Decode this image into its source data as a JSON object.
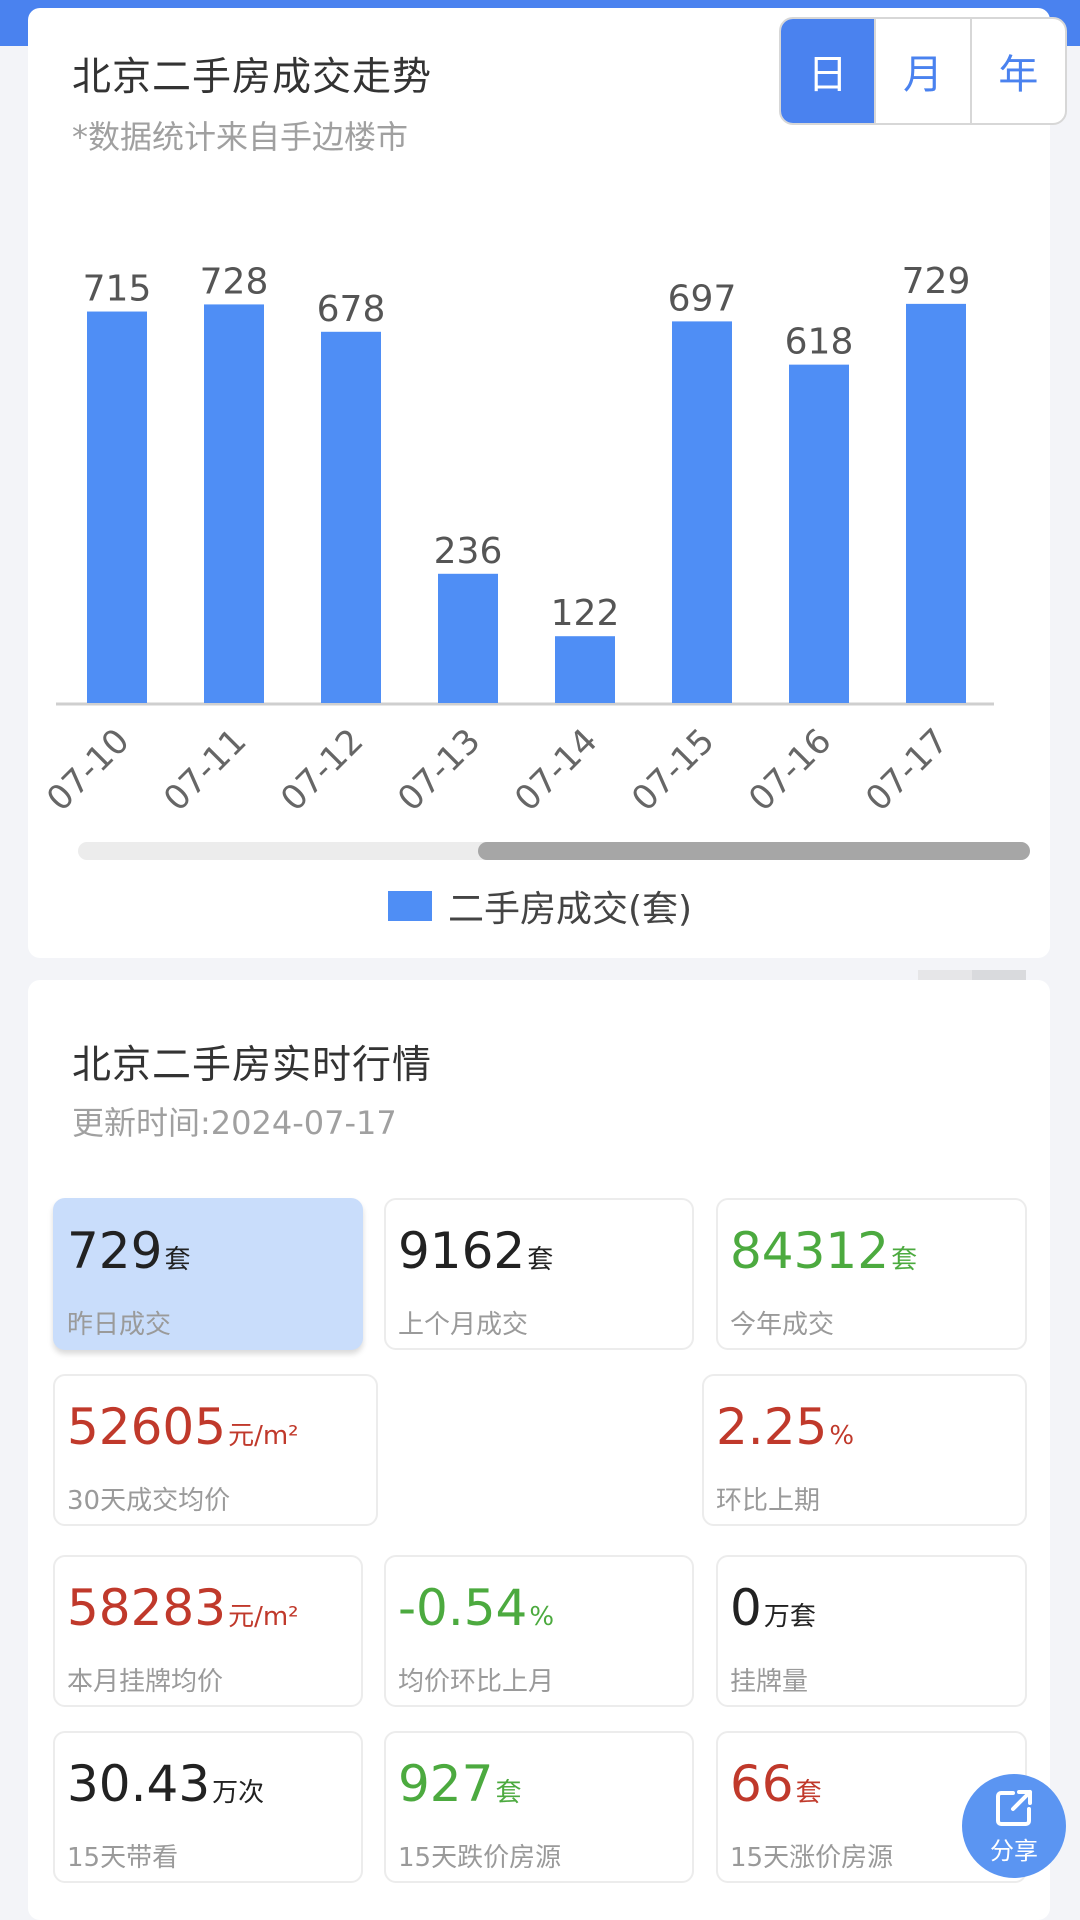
{
  "trend": {
    "title": "北京二手房成交走势",
    "subtitle": "*数据统计来自手边楼市",
    "periods": [
      "日",
      "月",
      "年"
    ],
    "active_period": "日"
  },
  "chart_data": {
    "type": "bar",
    "categories": [
      "07-10",
      "07-11",
      "07-12",
      "07-13",
      "07-14",
      "07-15",
      "07-16",
      "07-17"
    ],
    "series": [
      {
        "name": "二手房成交(套)",
        "values": [
          715,
          728,
          678,
          236,
          122,
          697,
          618,
          729
        ],
        "color": "#4f8ef5"
      }
    ],
    "data_labels": true,
    "x_label_rotation": "-45deg",
    "legend_position": "bottom-center",
    "grid": false
  },
  "market": {
    "title": "北京二手房实时行情",
    "updated": "更新时间:2024-07-17",
    "stats": [
      {
        "value": "729",
        "unit": "套",
        "label": "昨日成交",
        "color": "black",
        "highlight": true
      },
      {
        "value": "9162",
        "unit": "套",
        "label": "上个月成交",
        "color": "black"
      },
      {
        "value": "84312",
        "unit": "套",
        "label": "今年成交",
        "color": "green"
      },
      {
        "value": "52605",
        "unit": "元/m²",
        "label": "30天成交均价",
        "color": "red"
      },
      {
        "value": "2.25",
        "unit": "%",
        "label": "环比上期",
        "color": "red"
      },
      {
        "value": "58283",
        "unit": "元/m²",
        "label": "本月挂牌均价",
        "color": "red"
      },
      {
        "value": "-0.54",
        "unit": "%",
        "label": "均价环比上月",
        "color": "green"
      },
      {
        "value": "0",
        "unit": "万套",
        "label": "挂牌量",
        "color": "black"
      },
      {
        "value": "30.43",
        "unit": "万次",
        "label": "15天带看",
        "color": "black"
      },
      {
        "value": "927",
        "unit": "套",
        "label": "15天跌价房源",
        "color": "green"
      },
      {
        "value": "66",
        "unit": "套",
        "label": "15天涨价房源",
        "color": "red"
      }
    ]
  },
  "share": {
    "label": "分享",
    "icon": "share-icon"
  },
  "colors": {
    "accent": "#4a82ef",
    "bar": "#4f8ef5",
    "red": "#c0392b",
    "green": "#4caa3f"
  }
}
